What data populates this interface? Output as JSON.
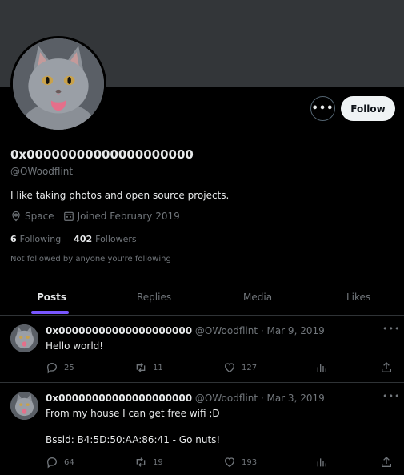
{
  "profile": {
    "display_name": "0x00000000000000000000",
    "handle": "@OWoodflint",
    "bio": "I like taking photos and open source projects.",
    "location": "Space",
    "joined": "Joined February 2019",
    "following_count": "6",
    "following_label": "Following",
    "followers_count": "402",
    "followers_label": "Followers",
    "not_followed_text": "Not followed by anyone you're following"
  },
  "actions": {
    "more_label": "•••",
    "follow_label": "Follow"
  },
  "tabs": [
    {
      "label": "Posts",
      "active": true
    },
    {
      "label": "Replies",
      "active": false
    },
    {
      "label": "Media",
      "active": false
    },
    {
      "label": "Likes",
      "active": false
    }
  ],
  "posts": [
    {
      "name": "0x00000000000000000000",
      "handle_date": "@OWoodflint · Mar 9, 2019",
      "lines": [
        "Hello world!"
      ],
      "replies": "25",
      "reposts": "11",
      "likes": "127",
      "more_label": "•••"
    },
    {
      "name": "0x00000000000000000000",
      "handle_date": "@OWoodflint · Mar 3, 2019",
      "lines": [
        "From my house I can get free wifi ;D",
        "",
        "Bssid: B4:5D:50:AA:86:41 - Go nuts!"
      ],
      "replies": "64",
      "reposts": "19",
      "likes": "193",
      "more_label": "•••"
    }
  ],
  "icons": {
    "location": "location-pin-icon",
    "calendar": "calendar-icon",
    "reply": "reply-icon",
    "repost": "repost-icon",
    "like": "heart-icon",
    "views": "analytics-icon",
    "share": "share-icon"
  },
  "colors": {
    "background": "#000000",
    "banner": "#333639",
    "text": "#e7e9ea",
    "muted": "#71767b",
    "tab_indicator": "#7856ff",
    "follow_button": "#eff3f4"
  }
}
